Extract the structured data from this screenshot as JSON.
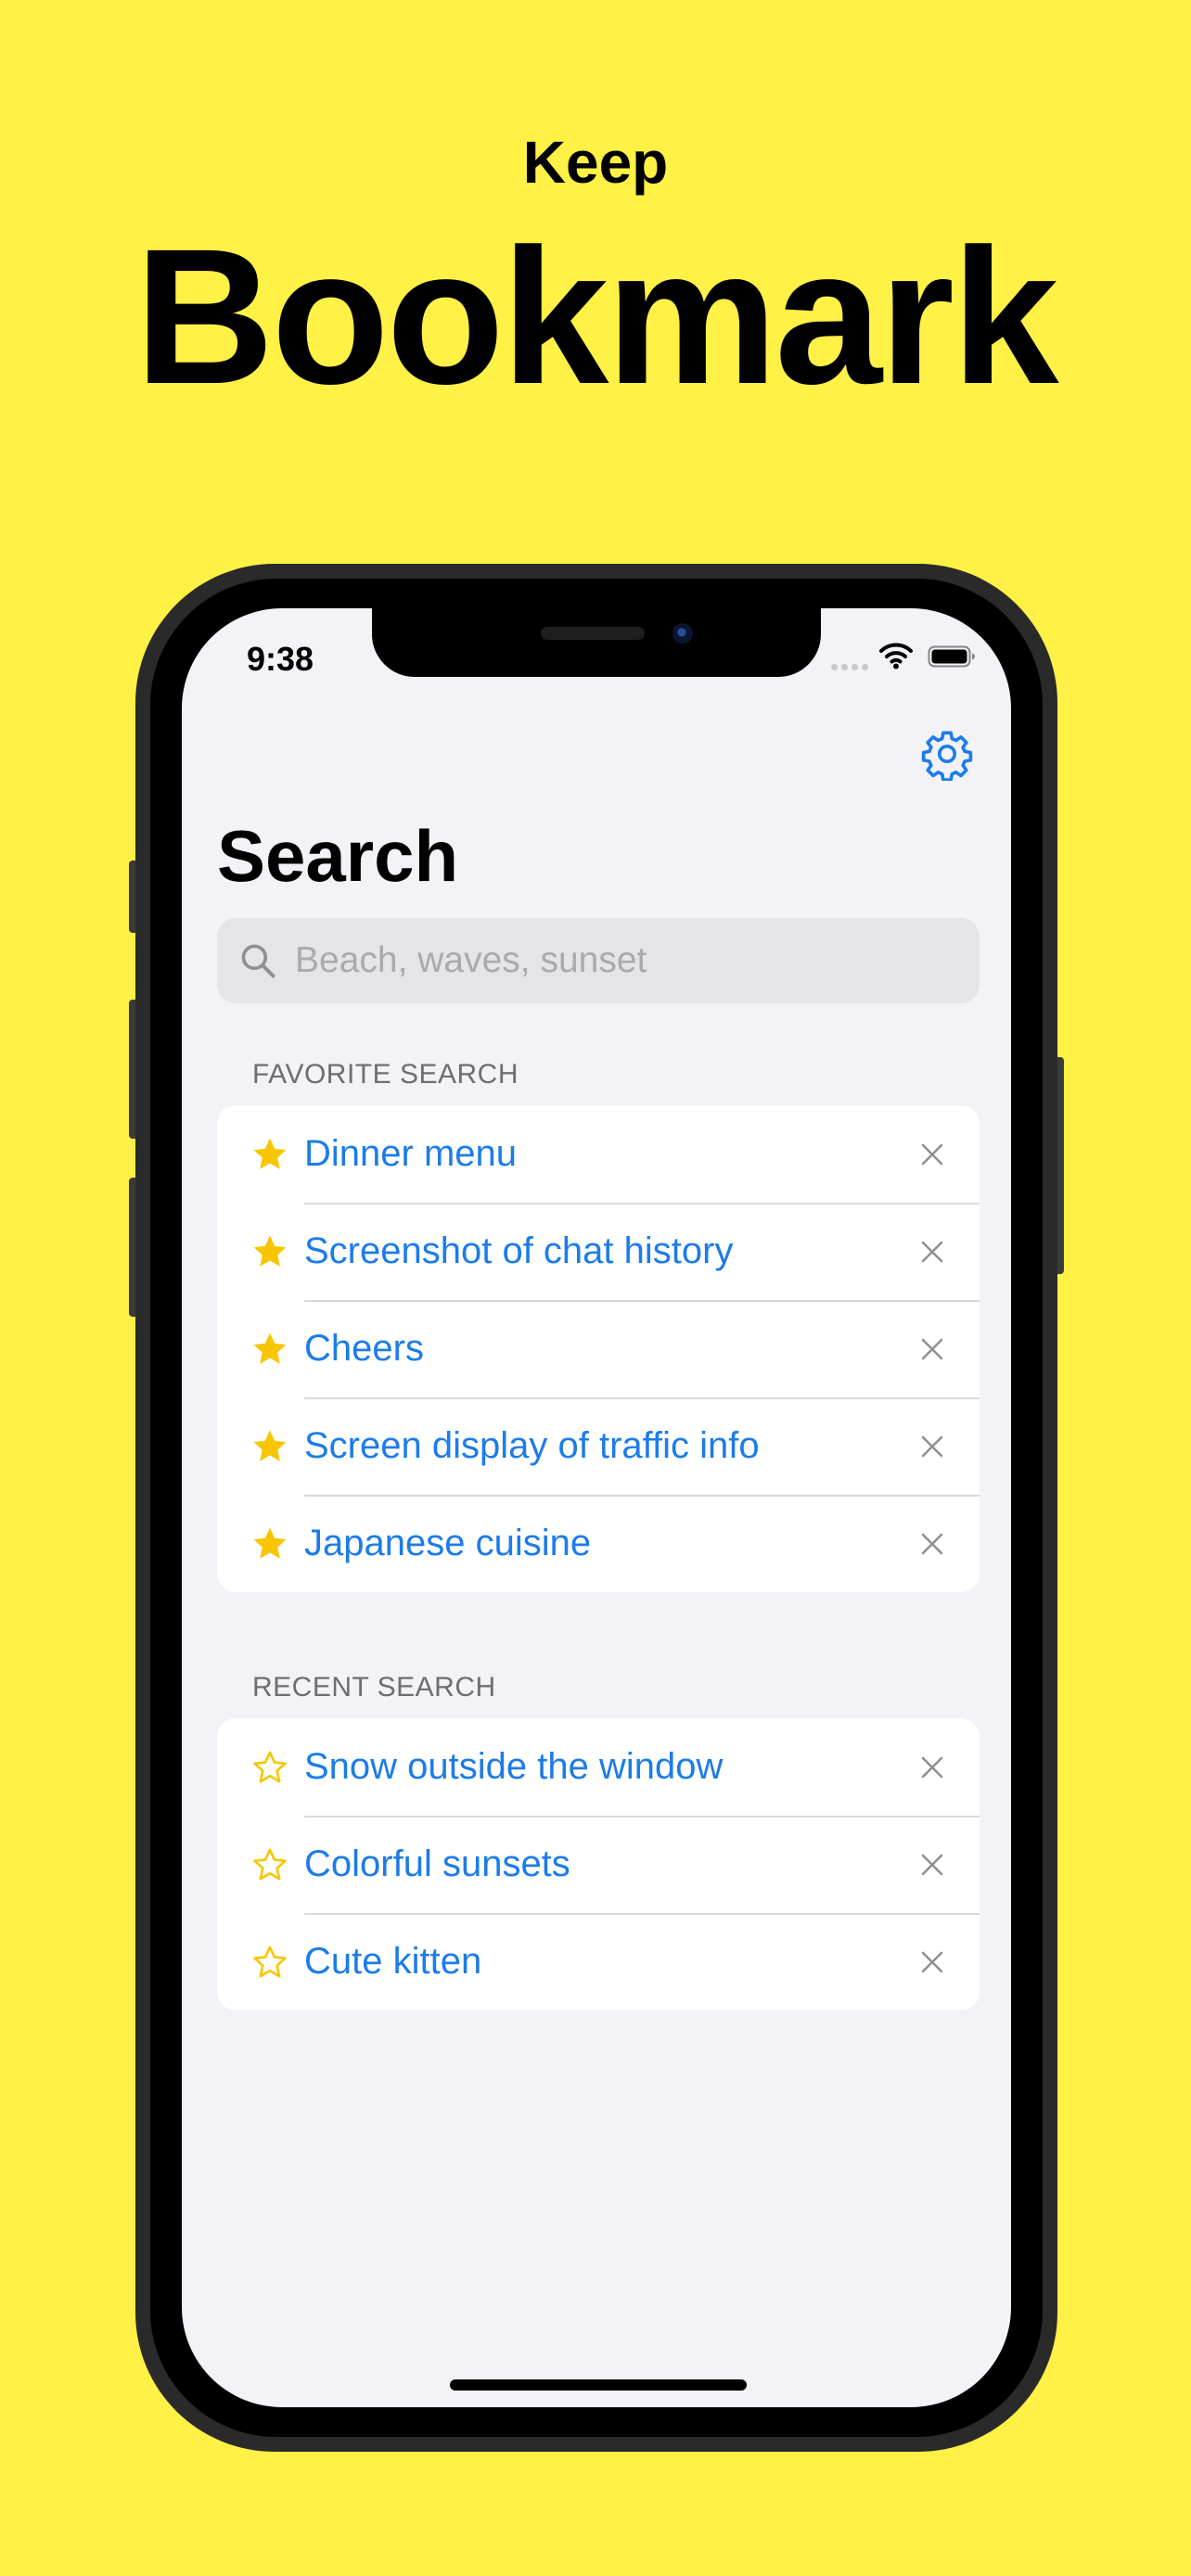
{
  "promo": {
    "kicker": "Keep",
    "title": "Bookmark"
  },
  "status_bar": {
    "time": "9:38",
    "icons": [
      "cellular-dots-icon",
      "wifi-icon",
      "battery-icon"
    ]
  },
  "toolbar": {
    "settings_icon": "gear-icon"
  },
  "screen": {
    "title": "Search"
  },
  "search": {
    "value": "",
    "placeholder": "Beach, waves, sunset",
    "icon": "search-icon"
  },
  "favorites": {
    "header": "FAVORITE SEARCH",
    "icon": "star-filled-icon",
    "items": [
      {
        "label": "Dinner menu"
      },
      {
        "label": "Screenshot of chat history"
      },
      {
        "label": "Cheers"
      },
      {
        "label": "Screen display of traffic info"
      },
      {
        "label": "Japanese cuisine"
      }
    ]
  },
  "recent": {
    "header": "RECENT SEARCH",
    "icon": "star-outline-icon",
    "items": [
      {
        "label": "Snow outside the window"
      },
      {
        "label": "Colorful sunsets"
      },
      {
        "label": "Cute kitten"
      }
    ]
  },
  "colors": {
    "background": "#FFF145",
    "accent": "#1C7CE9",
    "star": "#F7C600",
    "screen_bg": "#F2F2F7"
  }
}
